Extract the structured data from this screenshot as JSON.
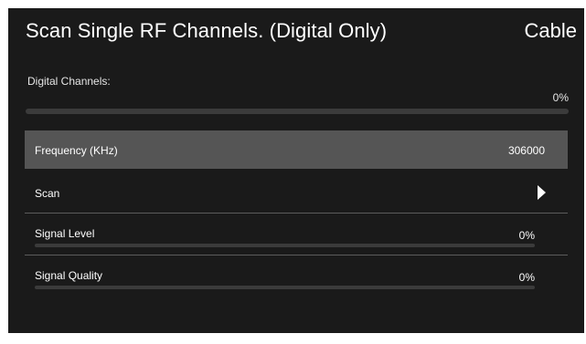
{
  "header": {
    "title": "Scan Single RF Channels. (Digital Only)",
    "mode": "Cable"
  },
  "digital_channels": {
    "label": "Digital Channels:",
    "progress_text": "0%",
    "progress": 0
  },
  "rows": {
    "frequency": {
      "label": "Frequency (KHz)",
      "value": "306000"
    },
    "scan": {
      "label": "Scan",
      "icon": "play-icon"
    },
    "signal_level": {
      "label": "Signal Level",
      "value": "0%",
      "level": 0
    },
    "signal_quality": {
      "label": "Signal Quality",
      "value": "0%",
      "level": 0
    }
  },
  "colors": {
    "background": "#1a1a1a",
    "selected_row": "#555555",
    "track": "#3b3b3b",
    "text": "#ffffff"
  }
}
